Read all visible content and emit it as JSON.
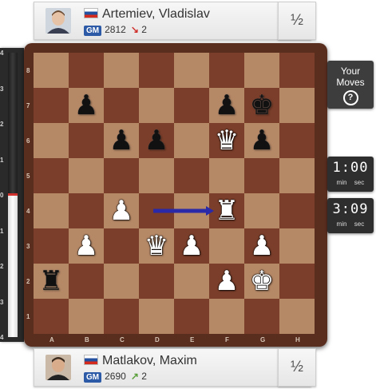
{
  "top_player": {
    "name": "Artemiev, Vladislav",
    "title": "GM",
    "rating": "2812",
    "rating_change": "2",
    "rating_change_direction": "down",
    "result": "½",
    "flag": "russia-flag"
  },
  "bottom_player": {
    "name": "Matlakov, Maxim",
    "title": "GM",
    "rating": "2690",
    "rating_change": "2",
    "rating_change_direction": "up",
    "result": "½",
    "flag": "russia-flag"
  },
  "eval_bar": {
    "labels": [
      "4",
      "3",
      "2",
      "1",
      "0",
      "1",
      "2",
      "3",
      "4"
    ]
  },
  "board": {
    "ranks": [
      "8",
      "7",
      "6",
      "5",
      "4",
      "3",
      "2",
      "1"
    ],
    "files": [
      "A",
      "B",
      "C",
      "D",
      "E",
      "F",
      "G",
      "H"
    ],
    "pieces": [
      {
        "square": "b7",
        "piece": "pawn",
        "color": "black"
      },
      {
        "square": "f7",
        "piece": "pawn",
        "color": "black"
      },
      {
        "square": "g7",
        "piece": "king",
        "color": "black"
      },
      {
        "square": "c6",
        "piece": "pawn",
        "color": "black"
      },
      {
        "square": "d6",
        "piece": "pawn",
        "color": "black"
      },
      {
        "square": "f6",
        "piece": "queen",
        "color": "white"
      },
      {
        "square": "g6",
        "piece": "pawn",
        "color": "black"
      },
      {
        "square": "c4",
        "piece": "pawn",
        "color": "white"
      },
      {
        "square": "f4",
        "piece": "rook",
        "color": "white"
      },
      {
        "square": "b3",
        "piece": "pawn",
        "color": "white"
      },
      {
        "square": "d3",
        "piece": "queen",
        "color": "white"
      },
      {
        "square": "e3",
        "piece": "pawn",
        "color": "white"
      },
      {
        "square": "g3",
        "piece": "pawn",
        "color": "white"
      },
      {
        "square": "a2",
        "piece": "rook",
        "color": "black"
      },
      {
        "square": "f2",
        "piece": "pawn",
        "color": "white"
      },
      {
        "square": "g2",
        "piece": "king",
        "color": "white"
      }
    ],
    "last_move_arrow": {
      "from": "d4",
      "to": "f4",
      "color": "#2a2aa8"
    }
  },
  "your_moves": {
    "label_line1": "Your",
    "label_line2": "Moves",
    "help_icon": "question-icon"
  },
  "clocks": {
    "top": {
      "time": "1:00",
      "unit_min": "min",
      "unit_sec": "sec"
    },
    "bottom": {
      "time": "3:09",
      "unit_min": "min",
      "unit_sec": "sec"
    }
  },
  "colors": {
    "light_square": "#b58866",
    "dark_square": "#7a3e2a",
    "frame": "#5a2e1f",
    "title_badge": "#2d5aa6"
  }
}
